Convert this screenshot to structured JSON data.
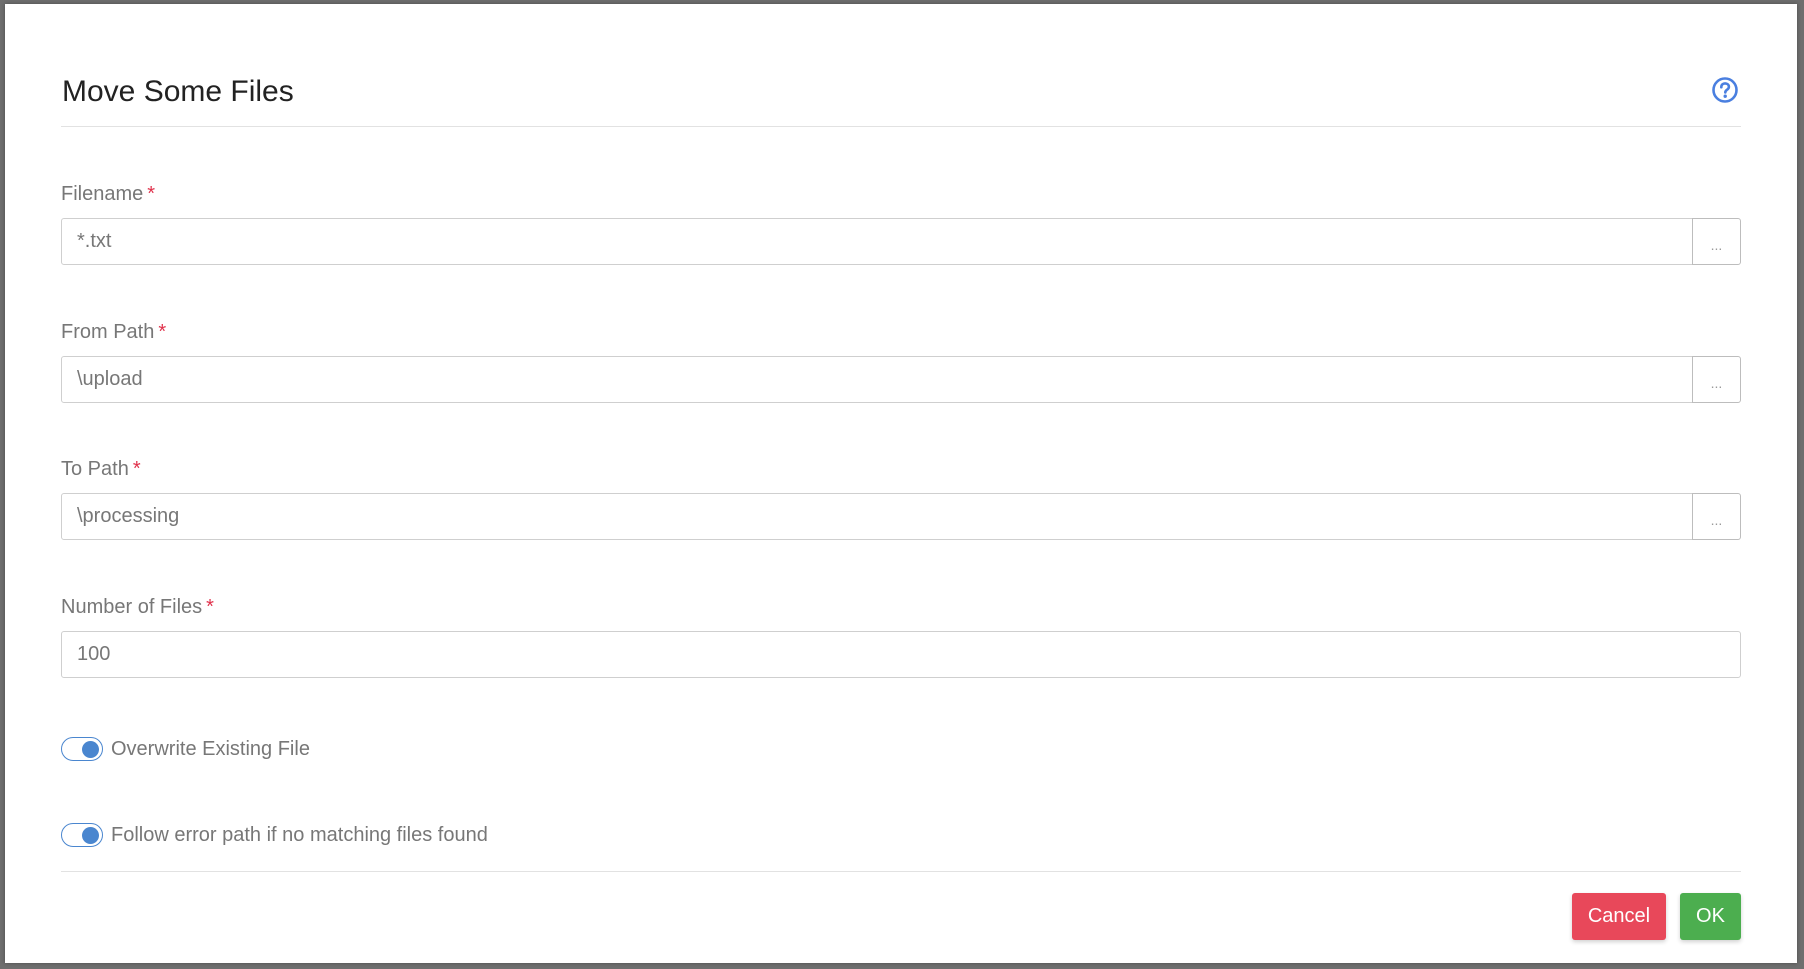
{
  "dialog": {
    "title": "Move Some Files",
    "help_icon": "question-circle-icon",
    "accent_color": "#4a86cf"
  },
  "fields": [
    {
      "label": "Filename",
      "required_marker": "*",
      "value": "*.txt",
      "browse_label": "..."
    },
    {
      "label": "From Path",
      "required_marker": "*",
      "value": "\\upload",
      "browse_label": "..."
    },
    {
      "label": "To Path",
      "required_marker": "*",
      "value": "\\processing",
      "browse_label": "..."
    },
    {
      "label": "Number of Files",
      "required_marker": "*",
      "value": "100"
    }
  ],
  "toggles": [
    {
      "label": "Overwrite Existing File",
      "checked": true
    },
    {
      "label": "Follow error path if no matching files found",
      "checked": true
    }
  ],
  "footer": {
    "cancel_label": "Cancel",
    "ok_label": "OK",
    "cancel_color": "#e8485a",
    "ok_color": "#4cae4f"
  }
}
